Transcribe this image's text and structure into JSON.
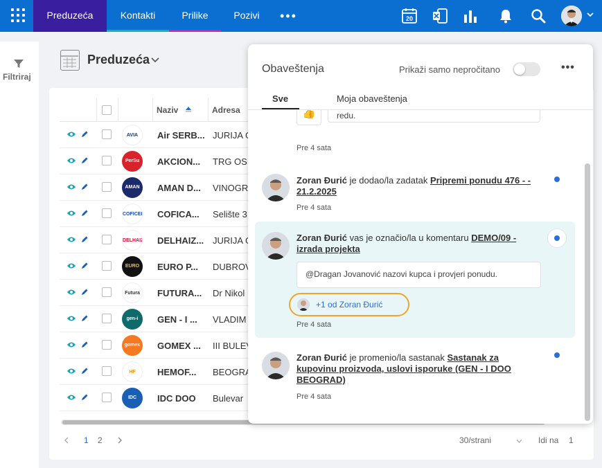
{
  "nav": {
    "tabs": [
      {
        "label": "Preduzeća"
      },
      {
        "label": "Kontakti"
      },
      {
        "label": "Prilike"
      },
      {
        "label": "Pozivi"
      }
    ],
    "more": "•••",
    "calendar_day": "20",
    "accent_active": "#3a1ea0",
    "accent_bar": "#0a6fd0"
  },
  "rail": {
    "filter_label": "Filtriraj"
  },
  "page": {
    "title": "Preduzeća"
  },
  "table": {
    "headers": {
      "name": "Naziv",
      "address": "Adresa"
    },
    "rows": [
      {
        "name": "Air SERB...",
        "address": "JURIJA G",
        "logo": "AVIA",
        "logo_bg": "#ffffff",
        "logo_fg": "#1a3a6a"
      },
      {
        "name": "AKCION...",
        "address": "TRG OSI",
        "logo": "PerSu",
        "logo_bg": "#d8232a",
        "logo_fg": "#ffffff"
      },
      {
        "name": "AMAN D...",
        "address": "VINOGR",
        "logo": "AMAN",
        "logo_bg": "#1a2a6a",
        "logo_fg": "#ffffff"
      },
      {
        "name": "COFICA...",
        "address": "Selište 3",
        "logo": "COFICEB",
        "logo_bg": "#ffffff",
        "logo_fg": "#1a4aa0"
      },
      {
        "name": "DELHAIZ...",
        "address": "JURIJA G",
        "logo": "DELHAIZE",
        "logo_bg": "#ffffff",
        "logo_fg": "#c8102e"
      },
      {
        "name": "EURO P...",
        "address": "DUBROV",
        "logo": "EURO PROM",
        "logo_bg": "#111111",
        "logo_fg": "#f0c030"
      },
      {
        "name": "FUTURA...",
        "address": "Dr Nikol",
        "logo": "Futura",
        "logo_bg": "#ffffff",
        "logo_fg": "#333333"
      },
      {
        "name": "GEN - I ...",
        "address": "VLADIM",
        "logo": "gen-i",
        "logo_bg": "#0f6b6b",
        "logo_fg": "#ffffff"
      },
      {
        "name": "GOMEX ...",
        "address": "III BULEV",
        "logo": "gomex",
        "logo_bg": "#f47920",
        "logo_fg": "#ffffff"
      },
      {
        "name": "HEMOF...",
        "address": "BEOGRA",
        "logo": "HF",
        "logo_bg": "#ffffff",
        "logo_fg": "#e8941a"
      },
      {
        "name": "IDC DOO",
        "address": "Bulevar",
        "logo": "IDC",
        "logo_bg": "#1a5fb4",
        "logo_fg": "#ffffff"
      }
    ]
  },
  "pager": {
    "page1": "1",
    "page2": "2",
    "per_page": "30/strani",
    "goto_label": "Idi na",
    "goto_value": "1"
  },
  "notifications": {
    "title": "Obaveštenja",
    "toggle_label": "Prikaži samo nepročitano",
    "more": "•••",
    "tabs": {
      "all": "Sve",
      "mine": "Moja obaveštenja"
    },
    "items": [
      {
        "quote": "@Jelena Janković prvi sastanak sa klijentom je bio u redu.",
        "time": "Pre 4 sata"
      },
      {
        "author": "Zoran Đurić",
        "action": " je dodao/la zadatak ",
        "link": "Pripremi ponudu 476 - - 21.2.2025",
        "time": "Pre 4 sata"
      },
      {
        "author": "Zoran Đurić",
        "action": " vas je označio/la u komentaru ",
        "link": "DEMO/09 - izrada projekta",
        "quote": "@Dragan Jovanović nazovi kupca i provjeri ponudu.",
        "plus": "+1 od Zoran Đurić",
        "time": "Pre 4 sata"
      },
      {
        "author": "Zoran Đurić",
        "action": " je promenio/la sastanak ",
        "link": "Sastanak za kupovinu proizvoda, uslovi isporuke (GEN - I DOO BEOGRAD)",
        "time": "Pre 4 sata"
      }
    ],
    "unread_color": "#2a6fd6",
    "highlight_color": "#e9f6f7",
    "focus_color": "#f0a52a"
  }
}
